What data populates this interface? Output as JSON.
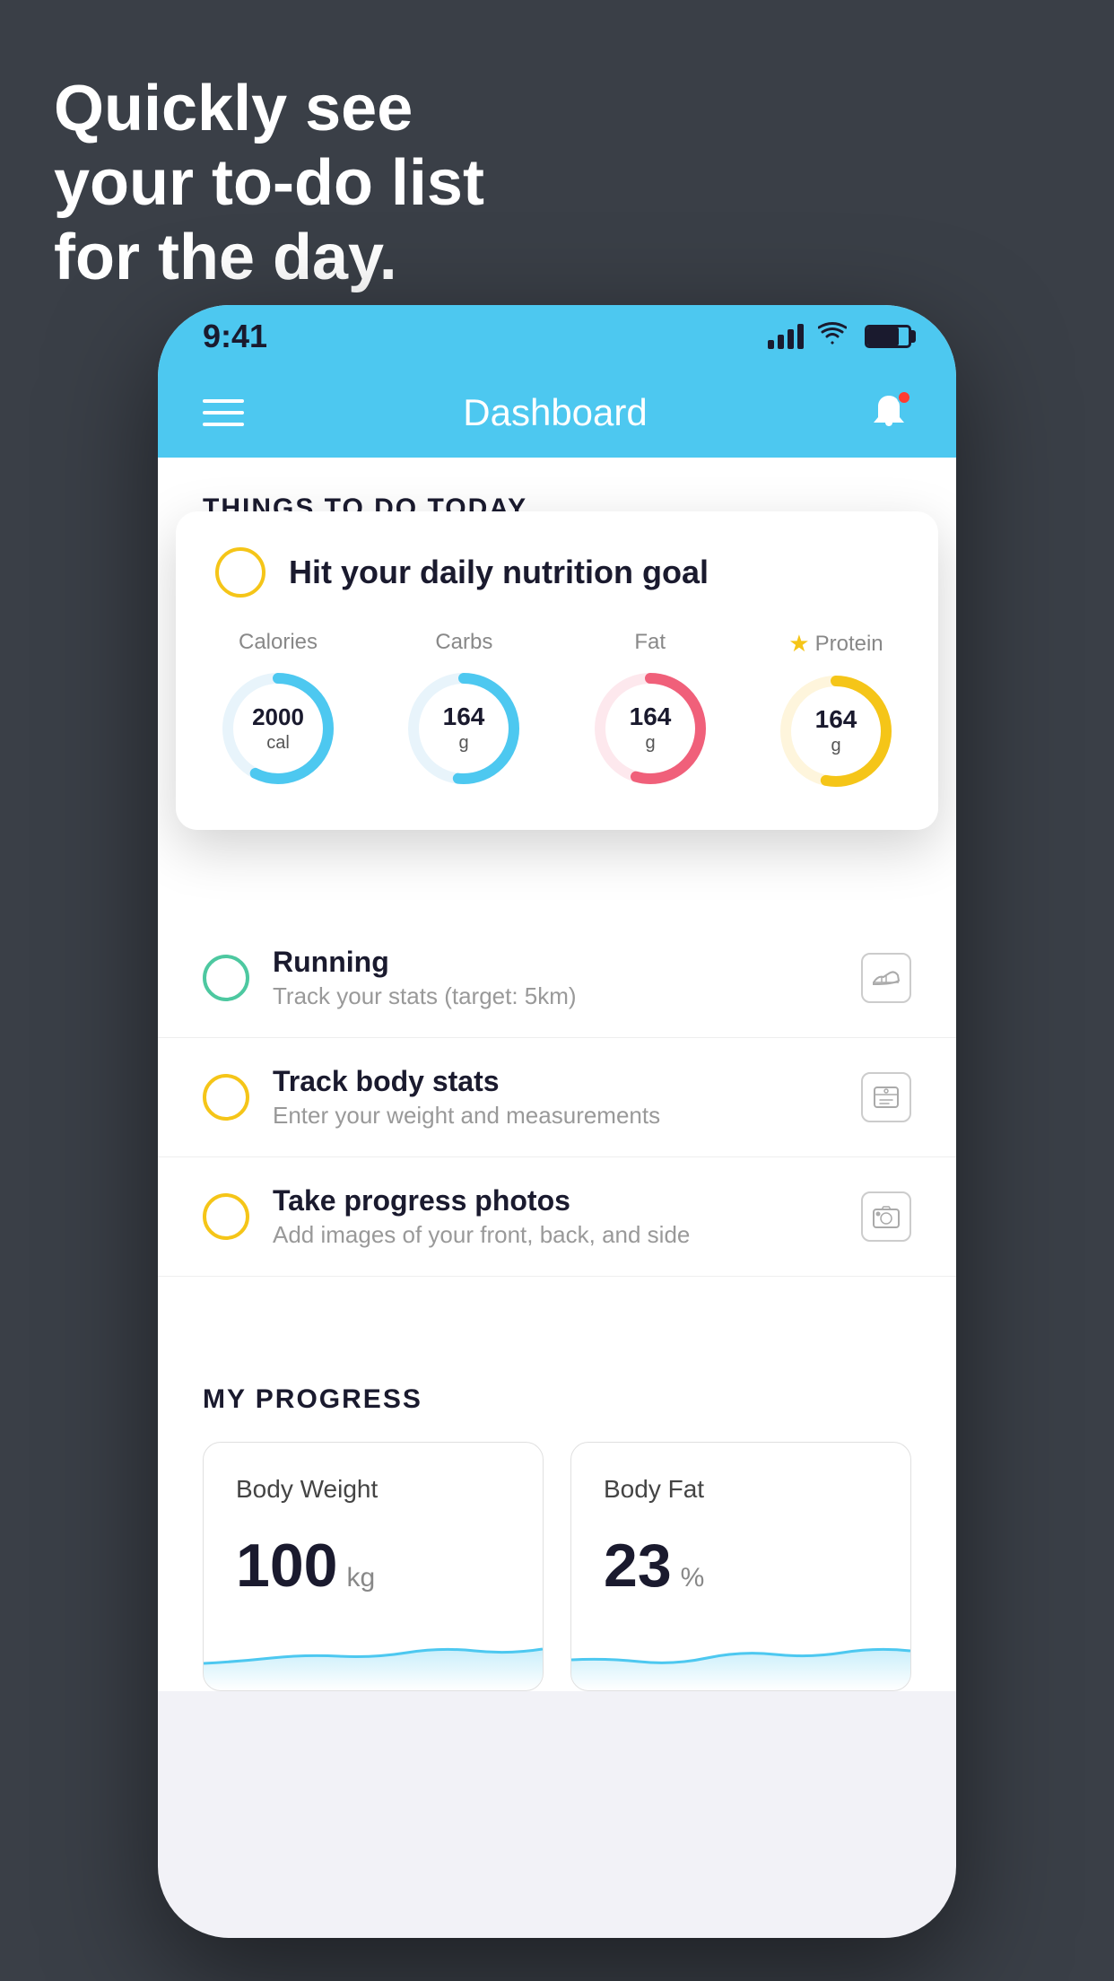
{
  "hero": {
    "title": "Quickly see\nyour to-do list\nfor the day."
  },
  "phone": {
    "statusBar": {
      "time": "9:41"
    },
    "navBar": {
      "title": "Dashboard"
    },
    "thingsToDo": {
      "sectionHeader": "THINGS TO DO TODAY"
    },
    "nutritionCard": {
      "title": "Hit your daily nutrition goal",
      "calories": {
        "label": "Calories",
        "value": "2000",
        "unit": "cal"
      },
      "carbs": {
        "label": "Carbs",
        "value": "164",
        "unit": "g"
      },
      "fat": {
        "label": "Fat",
        "value": "164",
        "unit": "g"
      },
      "protein": {
        "label": "Protein",
        "value": "164",
        "unit": "g"
      }
    },
    "todoItems": [
      {
        "title": "Running",
        "subtitle": "Track your stats (target: 5km)",
        "checkType": "green",
        "iconType": "shoe"
      },
      {
        "title": "Track body stats",
        "subtitle": "Enter your weight and measurements",
        "checkType": "yellow",
        "iconType": "scale"
      },
      {
        "title": "Take progress photos",
        "subtitle": "Add images of your front, back, and side",
        "checkType": "yellow",
        "iconType": "photo"
      }
    ],
    "myProgress": {
      "sectionHeader": "MY PROGRESS",
      "bodyWeight": {
        "title": "Body Weight",
        "value": "100",
        "unit": "kg"
      },
      "bodyFat": {
        "title": "Body Fat",
        "value": "23",
        "unit": "%"
      }
    }
  }
}
